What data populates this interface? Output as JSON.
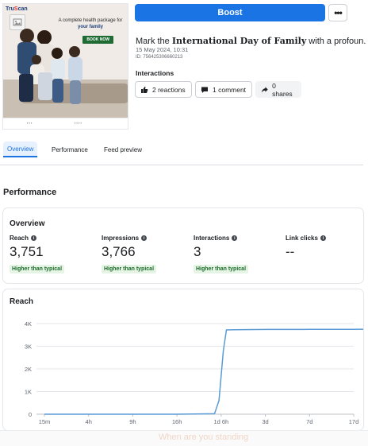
{
  "thumbnail": {
    "brand_prefix": "Tru",
    "brand_accent": "S",
    "brand_suffix": "can",
    "headline_line1": "A complete health package for",
    "headline_line2": "your family",
    "cta": "BOOK NOW"
  },
  "header": {
    "boost_label": "Boost",
    "more_label": "•••"
  },
  "post": {
    "title_prefix": "Mark the ",
    "title_bold": "International Day of Family",
    "title_suffix": " with a profoun...",
    "date": "15 May 2024, 10:31",
    "id": "ID: 756425306660213"
  },
  "interactions": {
    "label": "Interactions",
    "reactions": "2 reactions",
    "comments": "1 comment",
    "shares": "0 shares"
  },
  "tabs": [
    {
      "label": "Overview",
      "active": true
    },
    {
      "label": "Performance",
      "active": false
    },
    {
      "label": "Feed preview",
      "active": false
    }
  ],
  "performance": {
    "title": "Performance"
  },
  "overview": {
    "title": "Overview",
    "metrics": [
      {
        "label": "Reach",
        "value": "3,751",
        "badge": "Higher than typical"
      },
      {
        "label": "Impressions",
        "value": "3,766",
        "badge": "Higher than typical"
      },
      {
        "label": "Interactions",
        "value": "3",
        "badge": "Higher than typical"
      },
      {
        "label": "Link clicks",
        "value": "--",
        "badge": ""
      }
    ]
  },
  "chart_data": {
    "type": "line",
    "title": "Reach",
    "x_ticks": [
      "15m",
      "4h",
      "9h",
      "16h",
      "1d 6h",
      "3d",
      "7d",
      "17d"
    ],
    "y_ticks": [
      "0",
      "1K",
      "2K",
      "3K",
      "4K"
    ],
    "ylim": [
      0,
      4000
    ],
    "series": [
      {
        "color": "#5b9bd5",
        "points": [
          {
            "x": 0,
            "y": 0
          },
          {
            "x": 1,
            "y": 0
          },
          {
            "x": 2,
            "y": 0
          },
          {
            "x": 3,
            "y": 0
          },
          {
            "x": 3.85,
            "y": 20
          },
          {
            "x": 3.95,
            "y": 600
          },
          {
            "x": 4.05,
            "y": 2800
          },
          {
            "x": 4.12,
            "y": 3720
          },
          {
            "x": 4.3,
            "y": 3730
          },
          {
            "x": 5,
            "y": 3740
          },
          {
            "x": 6,
            "y": 3745
          },
          {
            "x": 7,
            "y": 3748
          },
          {
            "x": 7.6,
            "y": 3751
          }
        ]
      }
    ],
    "grid": true,
    "line_color": "#5b9bd5"
  },
  "footer": {
    "ghost_text": "When are you standing"
  }
}
